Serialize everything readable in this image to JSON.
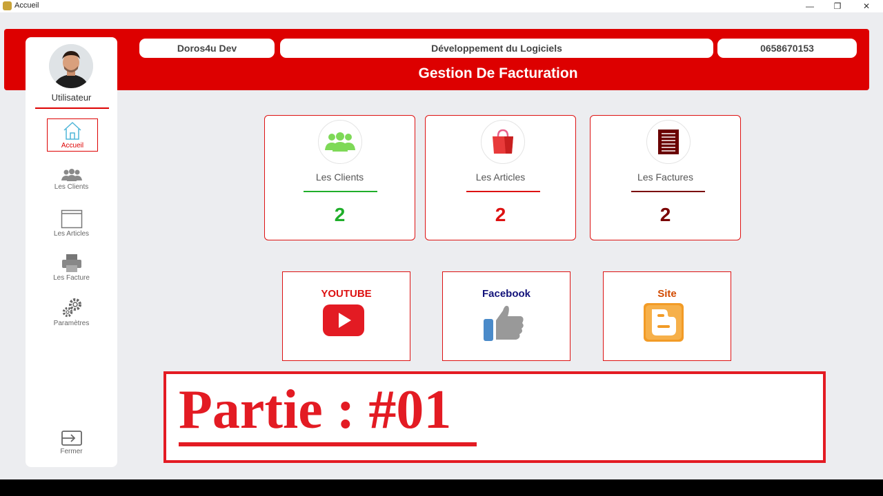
{
  "window": {
    "title": "Accueil"
  },
  "header": {
    "name": "Doros4u Dev",
    "description": "Développement du Logiciels",
    "phone": "0658670153",
    "title": "Gestion De Facturation"
  },
  "sidebar": {
    "user_label": "Utilisateur",
    "items": [
      {
        "label": "Accueil",
        "icon": "home-icon"
      },
      {
        "label": "Les Clients",
        "icon": "users-icon"
      },
      {
        "label": "Les Articles",
        "icon": "window-icon"
      },
      {
        "label": "Les Facture",
        "icon": "printer-icon"
      },
      {
        "label": "Paramètres",
        "icon": "gears-icon"
      }
    ],
    "close_label": "Fermer"
  },
  "cards": [
    {
      "label": "Les Clients",
      "count": "2",
      "color": "#1fae2a",
      "icon": "users-icon"
    },
    {
      "label": "Les Articles",
      "count": "2",
      "color": "#dd1111",
      "icon": "shopping-bag-icon"
    },
    {
      "label": "Les Factures",
      "count": "2",
      "color": "#7a0000",
      "icon": "invoice-icon"
    }
  ],
  "links": [
    {
      "label": "YOUTUBE",
      "color": "#dd1111",
      "icon": "youtube-play-icon"
    },
    {
      "label": "Facebook",
      "color": "#12127a",
      "icon": "thumbs-up-icon"
    },
    {
      "label": "Site",
      "color": "#d24a00",
      "icon": "blogger-icon"
    }
  ],
  "banner": {
    "text": "Partie : #01"
  }
}
